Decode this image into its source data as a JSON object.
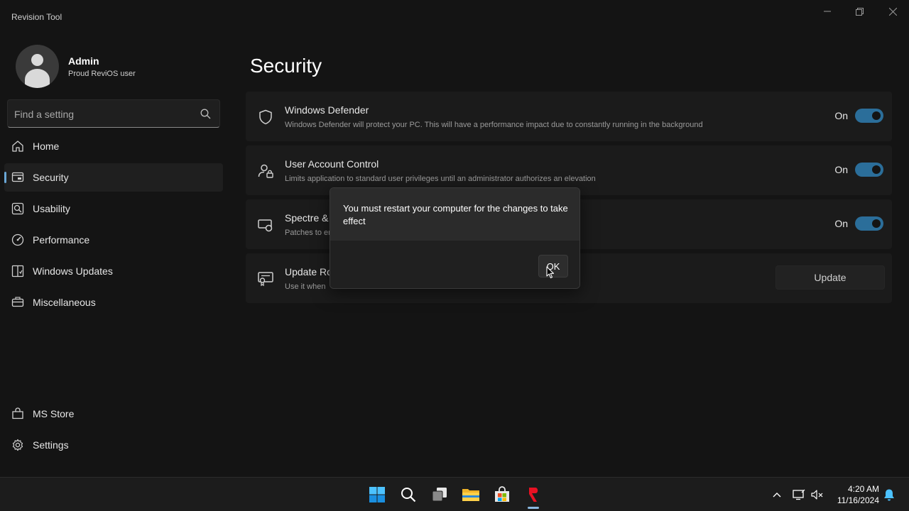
{
  "window": {
    "app_title": "Revision Tool"
  },
  "profile": {
    "name": "Admin",
    "subtitle": "Proud ReviOS user"
  },
  "search": {
    "placeholder": "Find a setting"
  },
  "sidebar": {
    "items": [
      {
        "label": "Home",
        "icon": "home-icon",
        "active": false
      },
      {
        "label": "Security",
        "icon": "security-icon",
        "active": true
      },
      {
        "label": "Usability",
        "icon": "usability-icon",
        "active": false
      },
      {
        "label": "Performance",
        "icon": "performance-icon",
        "active": false
      },
      {
        "label": "Windows Updates",
        "icon": "windows-updates-icon",
        "active": false
      },
      {
        "label": "Miscellaneous",
        "icon": "miscellaneous-icon",
        "active": false
      }
    ],
    "bottom_items": [
      {
        "label": "MS Store",
        "icon": "store-icon"
      },
      {
        "label": "Settings",
        "icon": "gear-icon"
      }
    ]
  },
  "main": {
    "title": "Security",
    "cards": [
      {
        "title": "Windows Defender",
        "description": "Windows Defender will protect your PC. This will have a performance impact due to constantly running in the background",
        "toggle_label": "On",
        "icon": "shield-icon"
      },
      {
        "title": "User Account Control",
        "description": "Limits application to standard user privileges until an administrator authorizes an elevation",
        "toggle_label": "On",
        "icon": "user-lock-icon"
      },
      {
        "title": "Spectre &",
        "description": "Patches to er",
        "toggle_label": "On",
        "icon": "spectre-icon"
      },
      {
        "title": "Update Ro",
        "description": "Use it when",
        "button_label": "Update",
        "icon": "certificate-icon"
      }
    ]
  },
  "dialog": {
    "message": "You must restart your computer for the changes to take effect",
    "ok_label": "OK"
  },
  "taskbar": {
    "icons": [
      "windows-start-icon",
      "search-icon",
      "task-view-icon",
      "file-explorer-icon",
      "ms-store-icon",
      "revision-tool-icon"
    ],
    "time": "4:20 AM",
    "date": "11/16/2024"
  },
  "colors": {
    "accent": "#2b6e9a",
    "background": "#141414",
    "card": "#1b1b1b"
  }
}
